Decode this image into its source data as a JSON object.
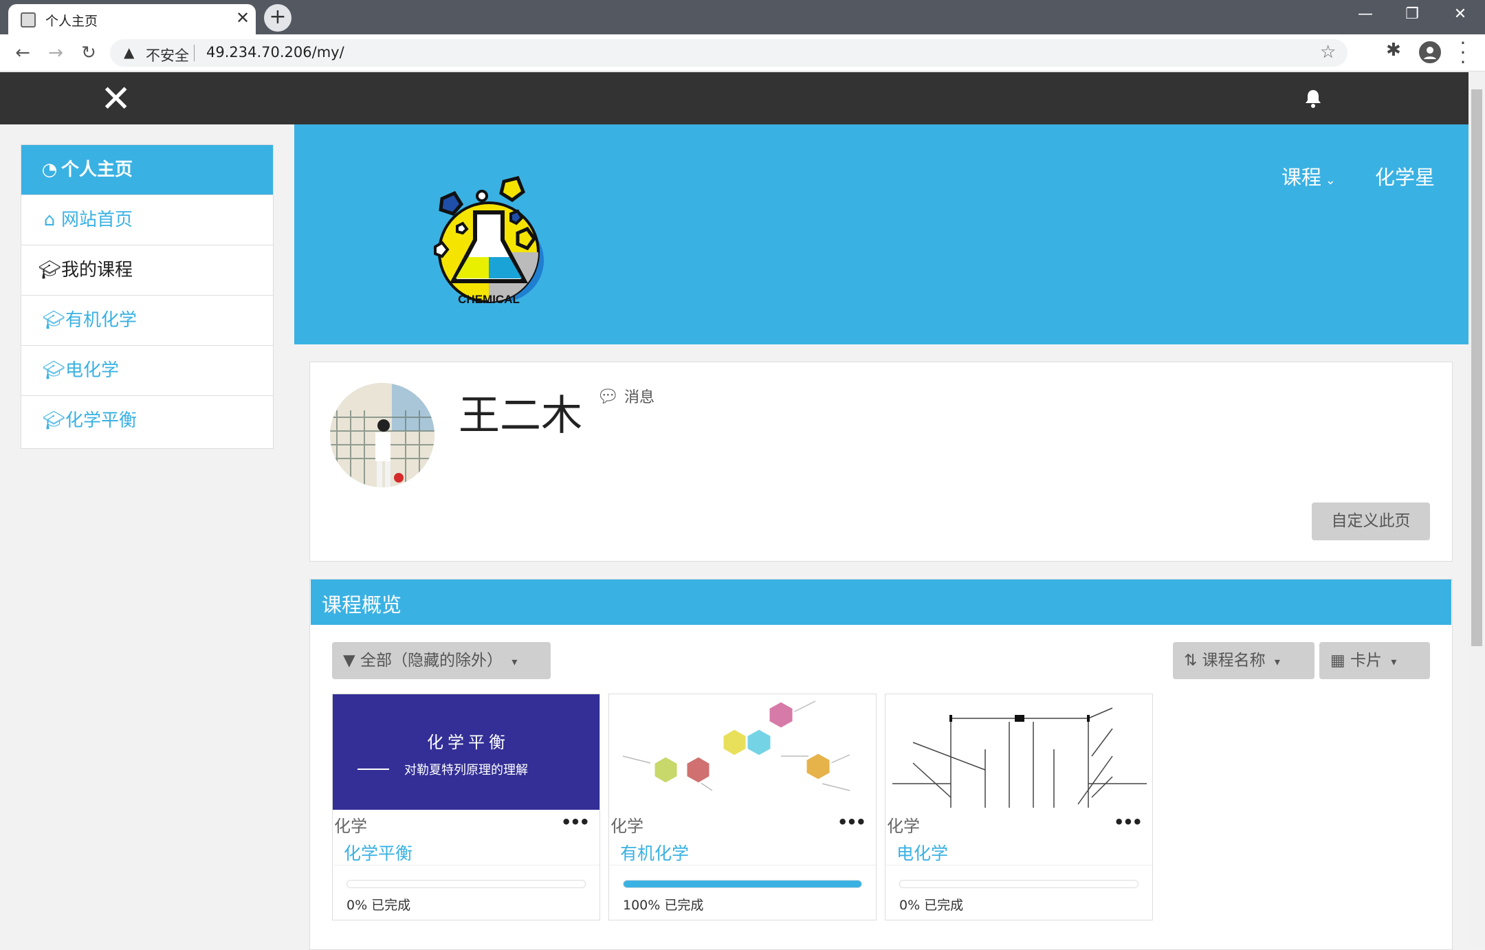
{
  "browser": {
    "tab_title": "个人主页",
    "tab_close": "✕",
    "new_tab": "+",
    "window_buttons": [
      "—",
      "❐",
      "✕"
    ],
    "security_label": "不安全",
    "url": "49.234.70.206/my/"
  },
  "topnav": {
    "close_glyph": "✕"
  },
  "sidebar": {
    "items": [
      {
        "label": "个人主页",
        "icon": "dashboard-icon"
      },
      {
        "label": "网站首页",
        "icon": "home-icon"
      },
      {
        "label": "我的课程",
        "icon": "graduation-cap-icon"
      },
      {
        "label": "有机化学",
        "icon": "graduation-cap-icon"
      },
      {
        "label": "电化学",
        "icon": "graduation-cap-icon"
      },
      {
        "label": "化学平衡",
        "icon": "graduation-cap-icon"
      }
    ]
  },
  "banner": {
    "menu_course": "课程",
    "menu_site": "化学星",
    "logo_text": "CHEMICAL"
  },
  "profile": {
    "name": "王二木",
    "message_label": "消息",
    "customize_button": "自定义此页"
  },
  "overview": {
    "title": "课程概览",
    "filter_label": "全部（隐藏的除外）",
    "sort_label": "课程名称",
    "view_label": "卡片",
    "courses": [
      {
        "category": "化学",
        "name": "化学平衡",
        "progress": 0,
        "progress_text": "0% 已完成",
        "image_title": "化 学 平 衡",
        "image_subtitle": "对勒夏特列原理的理解"
      },
      {
        "category": "化学",
        "name": "有机化学",
        "progress": 100,
        "progress_text": "100% 已完成"
      },
      {
        "category": "化学",
        "name": "电化学",
        "progress": 0,
        "progress_text": "0% 已完成"
      }
    ]
  },
  "colors": {
    "accent": "#3ab1e3",
    "topbar": "#333333",
    "card_bg": "#332f96"
  }
}
